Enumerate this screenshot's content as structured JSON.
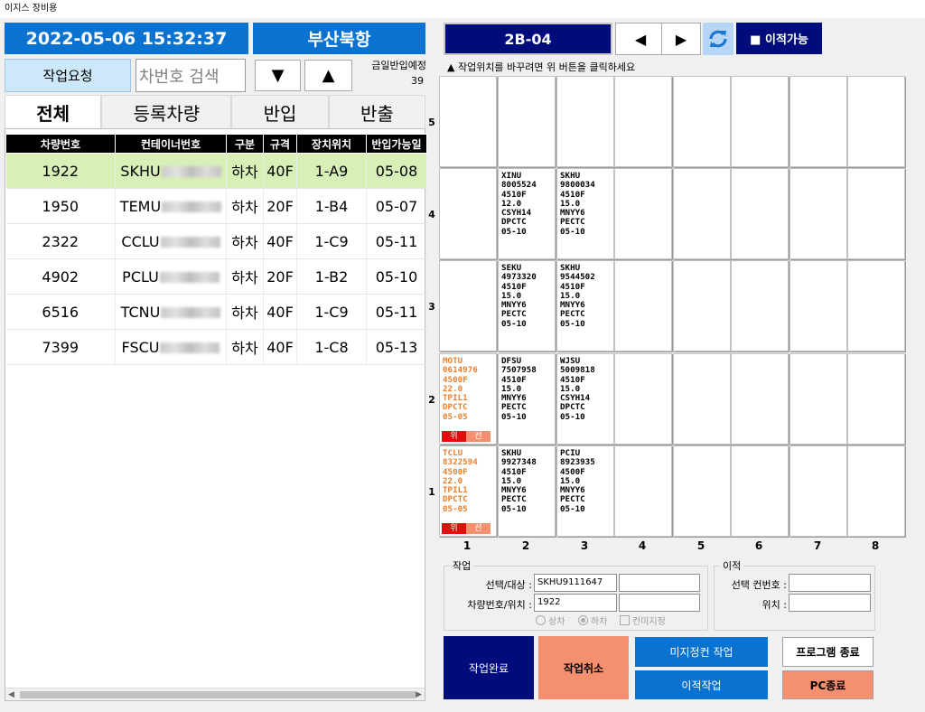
{
  "window": {
    "title": "이지스 장비용"
  },
  "header": {
    "datetime": "2022-05-06 15:32:37",
    "terminal": "부산북항"
  },
  "controls": {
    "work_request": "작업요청",
    "plate_search_placeholder": "차번호 검색",
    "down_arrow": "▼",
    "up_arrow": "▲",
    "today_in_label": "금일반입예정",
    "today_in_count": "39"
  },
  "tabs": [
    "전체",
    "등록차량",
    "반입",
    "반출"
  ],
  "table": {
    "headers": [
      "차량번호",
      "컨테이너번호",
      "구분",
      "규격",
      "장치위치",
      "반입가능일"
    ],
    "rows": [
      {
        "vehicle": "1922",
        "container": "SKHU",
        "type": "하차",
        "size": "40F",
        "location": "1-A9",
        "date": "05-08"
      },
      {
        "vehicle": "1950",
        "container": "TEMU",
        "type": "하차",
        "size": "20F",
        "location": "1-B4",
        "date": "05-07"
      },
      {
        "vehicle": "2322",
        "container": "CCLU",
        "type": "하차",
        "size": "40F",
        "location": "1-C9",
        "date": "05-11"
      },
      {
        "vehicle": "4902",
        "container": "PCLU",
        "type": "하차",
        "size": "20F",
        "location": "1-B2",
        "date": "05-10"
      },
      {
        "vehicle": "6516",
        "container": "TCNU",
        "type": "하차",
        "size": "40F",
        "location": "1-C9",
        "date": "05-11"
      },
      {
        "vehicle": "7399",
        "container": "FSCU",
        "type": "하차",
        "size": "40F",
        "location": "1-C8",
        "date": "05-13"
      }
    ]
  },
  "block": {
    "name": "2B-04",
    "prev": "◀",
    "next": "▶",
    "transfer_status": "■ 이적가능",
    "hint": "▲ 작업위치를 바꾸려면 위 버튼을 클릭하세요",
    "row_labels": [
      "5",
      "4",
      "3",
      "2",
      "1"
    ],
    "col_labels": [
      "1",
      "2",
      "3",
      "4",
      "5",
      "6",
      "7",
      "8"
    ],
    "slots": {
      "4-2": "XINU\n8005524\n4510F\n12.0\nCSYH14\nDPCTC\n05-10",
      "4-3": "SKHU\n9800034\n4510F\n15.0\nMNYY6\nPECTC\n05-10",
      "3-2": "SEKU\n4973320\n4510F\n15.0\nMNYY6\nPECTC\n05-10",
      "3-3": "SKHU\n9544502\n4510F\n15.0\nMNYY6\nPECTC\n05-10",
      "2-1": "MOTU\n0614976\n4500F\n22.0\nTPIL1\nDPCTC\n05-05",
      "2-2": "DFSU\n7507958\n4510F\n15.0\nMNYY6\nPECTC\n05-10",
      "2-3": "WJSU\n5009818\n4510F\n15.0\nCSYH14\nDPCTC\n05-10",
      "1-1": "TCLU\n8322594\n4500F\n22.0\nTPIL1\nDPCTC\n05-05",
      "1-2": "SKHU\n9927348\n4510F\n15.0\nMNYY6\nPECTC\n05-10",
      "1-3": "PCIU\n8923935\n4500F\n15.0\nMNYY6\nPECTC\n05-10"
    },
    "tag_up": "위",
    "tag_select": "선",
    "orange_color": "#e9812e"
  },
  "work": {
    "legend": "작업",
    "target_label": "선택/대상 :",
    "target_value": "SKHU9111647",
    "target_value2": "",
    "vehicle_label": "차량번호/위치 :",
    "vehicle_value": "1922",
    "vehicle_value2": "",
    "radio_load": "상차",
    "radio_unload": "하차",
    "check_unassigned": "컨미지정"
  },
  "transfer": {
    "legend": "이적",
    "container_label": "선택 컨번호 :",
    "container_value": "",
    "location_label": "위치 :",
    "location_value": ""
  },
  "buttons": {
    "complete": "작업완료",
    "cancel": "작업취소",
    "unassigned_work": "미지정컨 작업",
    "transfer_work": "이적작업",
    "exit_program": "프로그램 종료",
    "pc_shutdown": "PC종료"
  },
  "colors": {
    "header_blue": "#0a73d2",
    "navy": "#000c7b",
    "salmon": "#f4906f",
    "selected_row": "#d8efb7"
  }
}
